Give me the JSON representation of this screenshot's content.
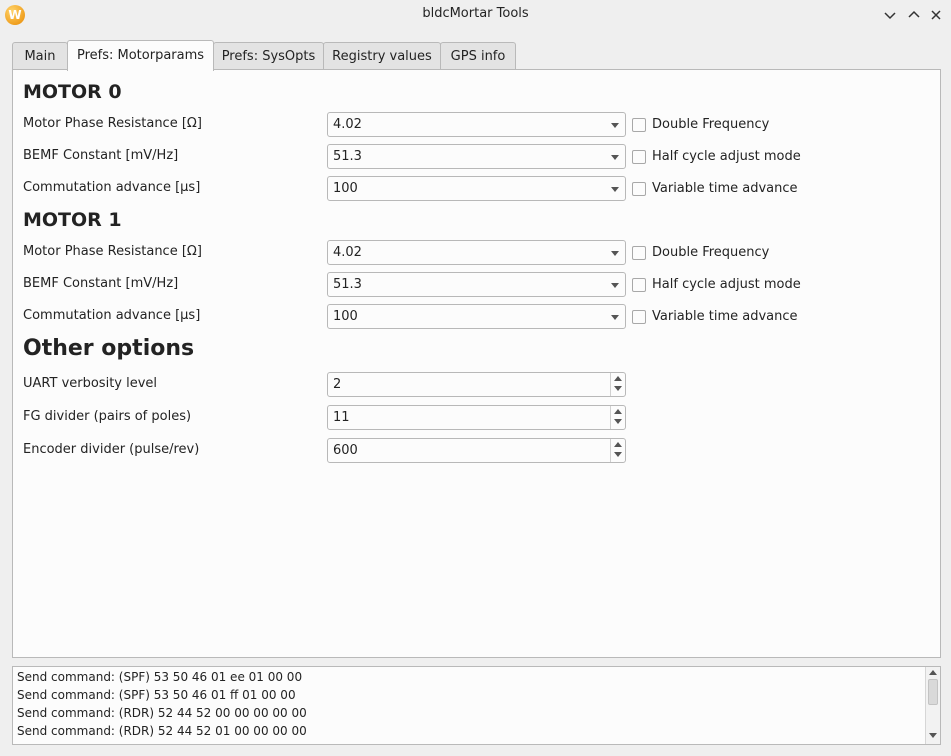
{
  "window": {
    "title": "bldcMortar Tools",
    "icon": "app-logo-icon"
  },
  "tabs": [
    {
      "label": "Main"
    },
    {
      "label": "Prefs: Motorparams",
      "active": true
    },
    {
      "label": "Prefs: SysOpts"
    },
    {
      "label": "Registry values"
    },
    {
      "label": "GPS info"
    }
  ],
  "motor0": {
    "title": "MOTOR 0",
    "rows": [
      {
        "label": "Motor Phase Resistance [Ω]",
        "value": "4.02",
        "check_label": "Double Frequency",
        "checked": false
      },
      {
        "label": "BEMF Constant [mV/Hz]",
        "value": "51.3",
        "check_label": "Half cycle adjust mode",
        "checked": false
      },
      {
        "label": "Commutation advance [µs]",
        "value": "100",
        "check_label": "Variable time advance",
        "checked": false
      }
    ]
  },
  "motor1": {
    "title": "MOTOR 1",
    "rows": [
      {
        "label": "Motor Phase Resistance [Ω]",
        "value": "4.02",
        "check_label": "Double Frequency",
        "checked": false
      },
      {
        "label": "BEMF Constant [mV/Hz]",
        "value": "51.3",
        "check_label": "Half cycle adjust mode",
        "checked": false
      },
      {
        "label": "Commutation advance [µs]",
        "value": "100",
        "check_label": "Variable time advance",
        "checked": false
      }
    ]
  },
  "other": {
    "title": "Other options",
    "rows": [
      {
        "label": "UART verbosity level",
        "value": "2"
      },
      {
        "label": "FG divider (pairs of poles)",
        "value": "11"
      },
      {
        "label": "Encoder divider (pulse/rev)",
        "value": "600"
      }
    ]
  },
  "log": [
    "Send command: (SPF) 53 50 46 01 ee 01 00 00",
    "Send command: (SPF) 53 50 46 01 ff 01 00 00",
    "Send command: (RDR) 52 44 52 00 00 00 00 00",
    "Send command: (RDR) 52 44 52 01 00 00 00 00"
  ]
}
